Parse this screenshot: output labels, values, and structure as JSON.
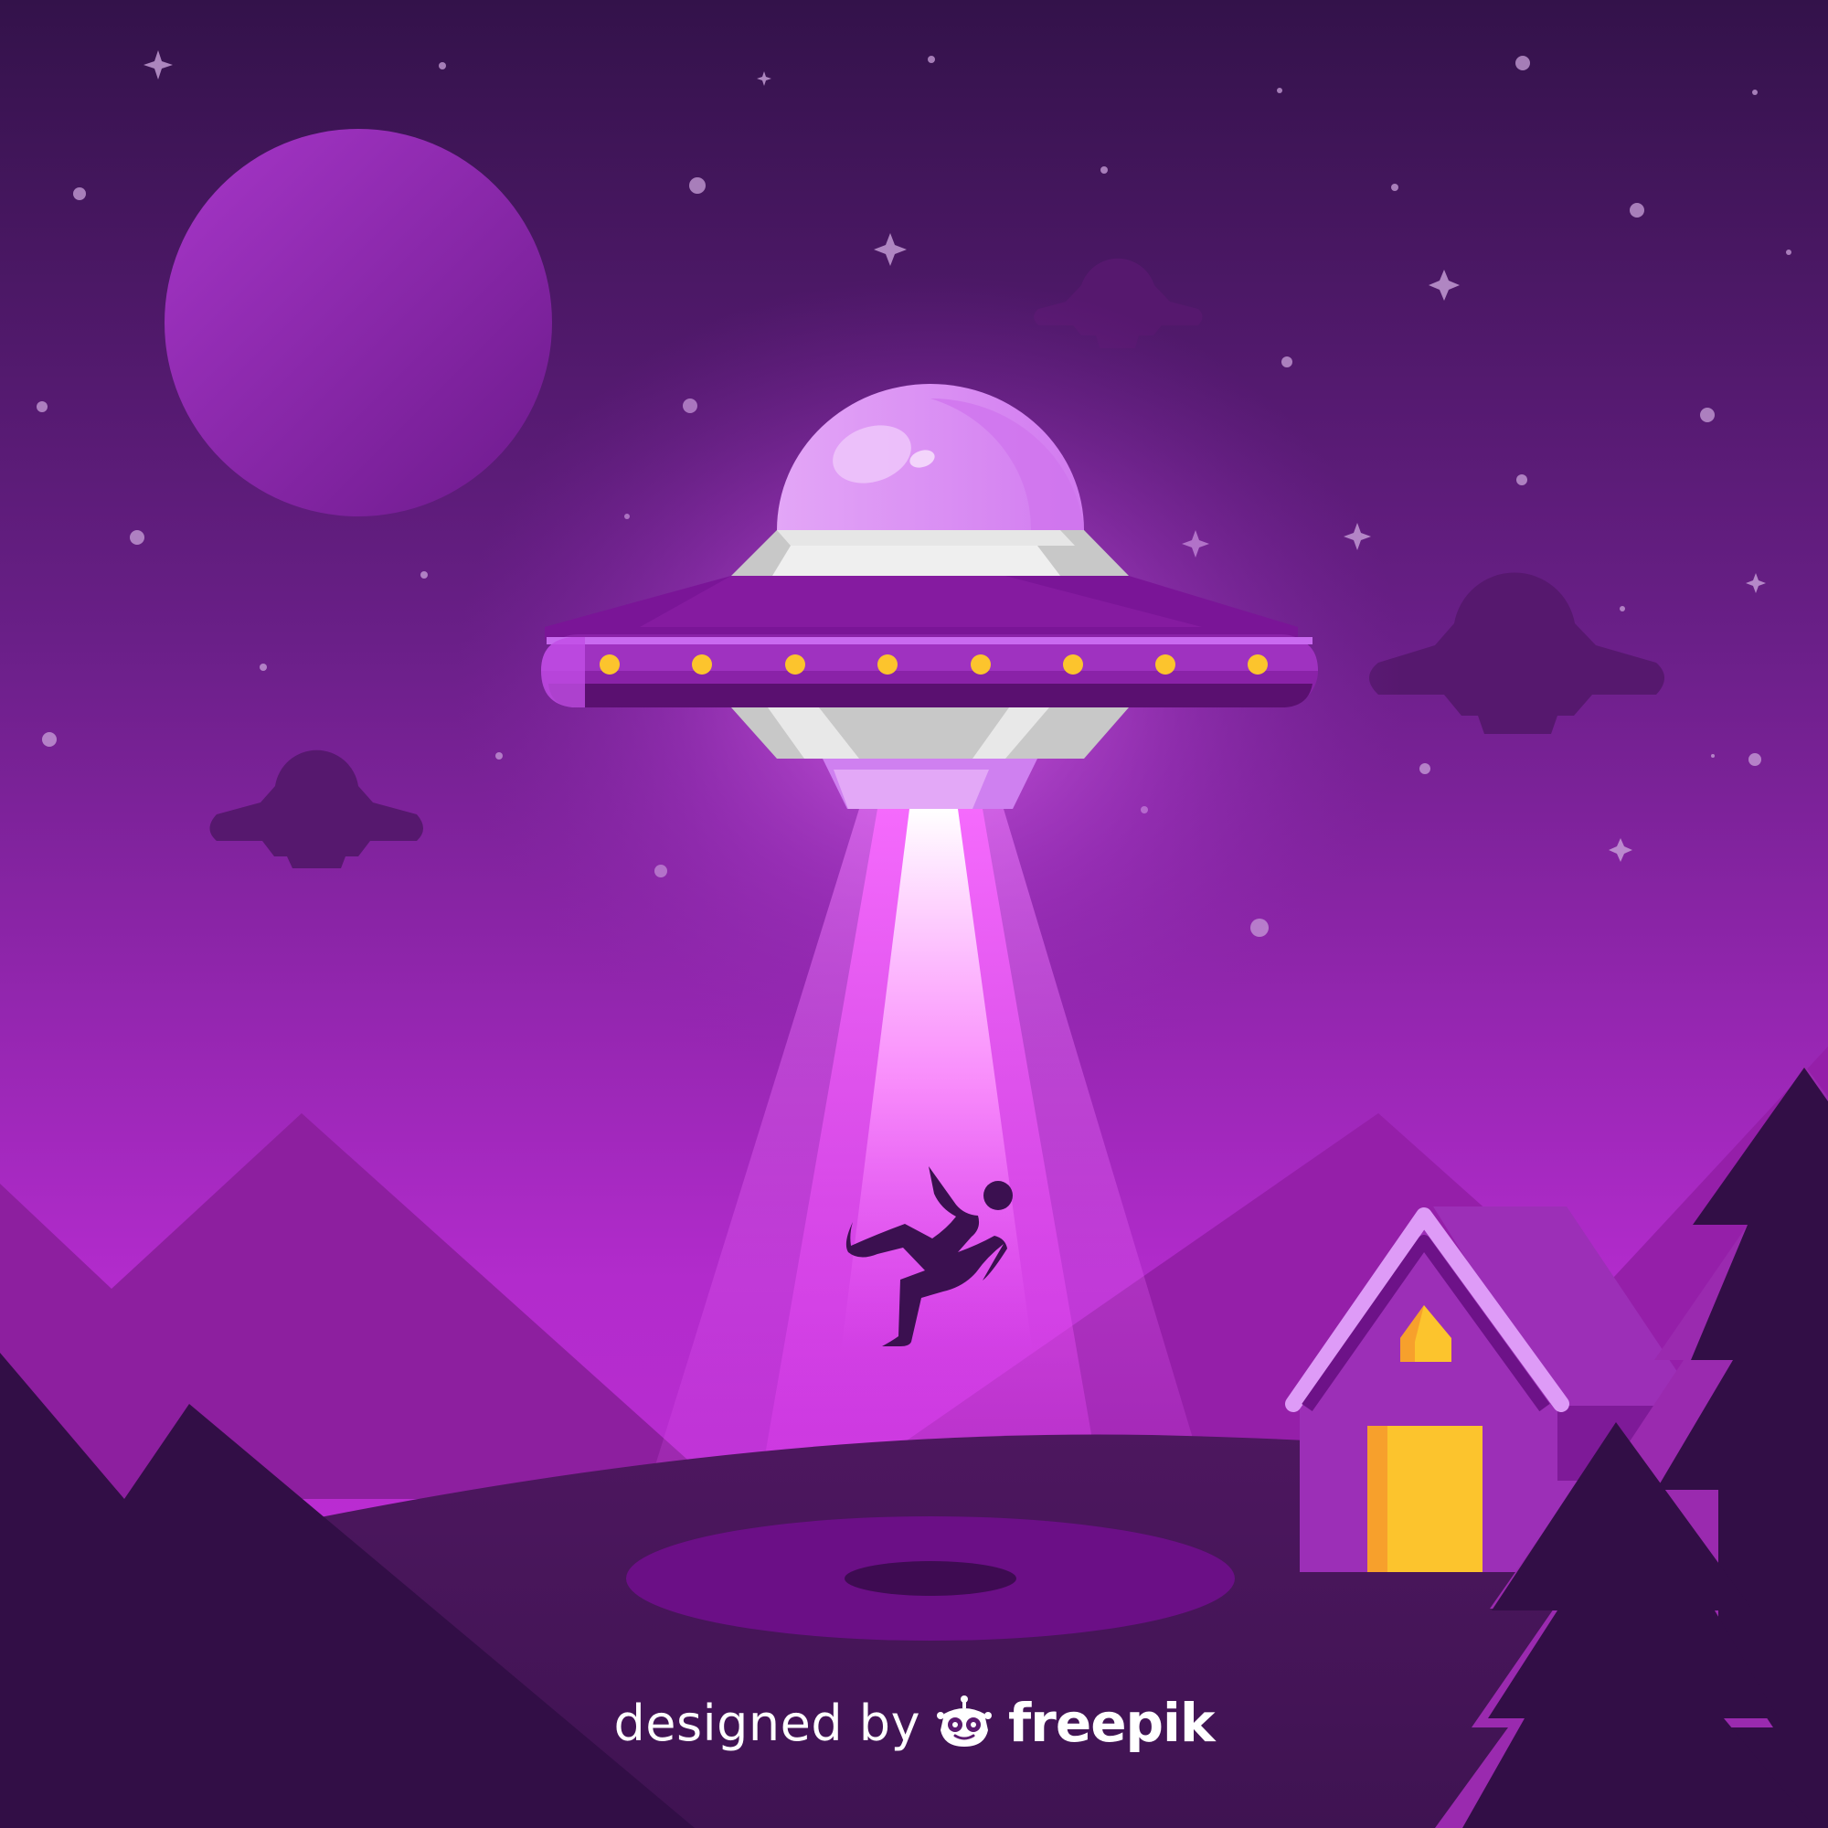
{
  "credit": {
    "prefix": "designed by",
    "brand": "freepik",
    "logo_icon": "freepik-robot-logo-icon"
  },
  "palette": {
    "sky_top": "#33124a",
    "sky_bottom": "#c02bd7",
    "moon": "#8e24b0",
    "ufo_body": "#7a1597",
    "ufo_dome": "#e07ff4",
    "ufo_lights": "#fcc42d",
    "beam": "#f36aff",
    "house": "#9c2fb7",
    "house_window": "#fcc42d",
    "trees": "#2f0d45"
  }
}
